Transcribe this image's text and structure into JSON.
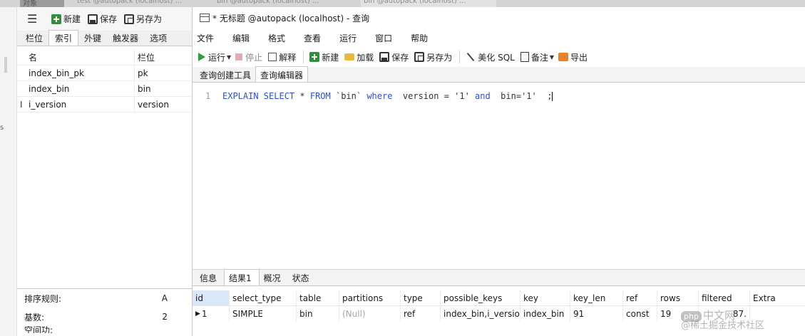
{
  "topstrip": {
    "tab1": "对象",
    "tab2": "test @autopack (localhost) ...",
    "tab3": "bin @autopack (localhost) ...",
    "tab4": "bin @autopack (localhost) ..."
  },
  "designer": {
    "toolbar": {
      "new_label": "新建",
      "save_label": "保存",
      "saveas_label": "另存为"
    },
    "tabs": [
      "栏位",
      "索引",
      "外键",
      "触发器",
      "选项"
    ],
    "active_tab": "索引",
    "grid": {
      "headers": [
        "名",
        "栏位"
      ],
      "rows": [
        {
          "name": "index_bin_pk",
          "field": "pk"
        },
        {
          "name": "index_bin",
          "field": "bin"
        },
        {
          "name": "i_version",
          "field": "version"
        }
      ]
    },
    "props": [
      {
        "label": "排序规则:",
        "value": "A"
      },
      {
        "label": "基数:",
        "value": "2"
      },
      {
        "label": "空间功:",
        "value": ""
      }
    ]
  },
  "window": {
    "title": "* 无标题 @autopack (localhost) - 查询",
    "menu": [
      "文件",
      "编辑",
      "格式",
      "查看",
      "运行",
      "窗口",
      "帮助"
    ],
    "toolbar": {
      "run": "运行",
      "stop": "停止",
      "explain": "解释",
      "new": "新建",
      "load": "加载",
      "save": "保存",
      "saveas": "另存为",
      "beautify": "美化 SQL",
      "note": "备注",
      "export": "导出"
    },
    "subtabs": [
      "查询创建工具",
      "查询编辑器"
    ],
    "active_subtab": "查询编辑器",
    "editor": {
      "line_number": "1",
      "tokens": {
        "t1": "EXPLAIN SELECT",
        "t2": " * ",
        "t3": "FROM",
        "t4": " `bin` ",
        "t5": "where",
        "t6": "  version = '1' ",
        "t7": "and",
        "t8": "  bin='1'  ;"
      }
    },
    "result_tabs": [
      "信息",
      "结果1",
      "概况",
      "状态"
    ],
    "active_result_tab": "结果1",
    "result": {
      "headers": [
        "id",
        "select_type",
        "table",
        "partitions",
        "type",
        "possible_keys",
        "key",
        "key_len",
        "ref",
        "rows",
        "filtered",
        "Extra"
      ],
      "rows": [
        [
          "1",
          "SIMPLE",
          "bin",
          "(Null)",
          "ref",
          "index_bin,i_version",
          "index_bin",
          "91",
          "const",
          "19",
          "87.",
          ""
        ]
      ]
    }
  },
  "watermark": {
    "badge": "php",
    "text": "中文网",
    "text2": "@稀土掘金技术社区"
  },
  "colors": {
    "keyword": "#2b4fd6",
    "selection": "#d9e7fb",
    "run": "#2e9e3a"
  }
}
